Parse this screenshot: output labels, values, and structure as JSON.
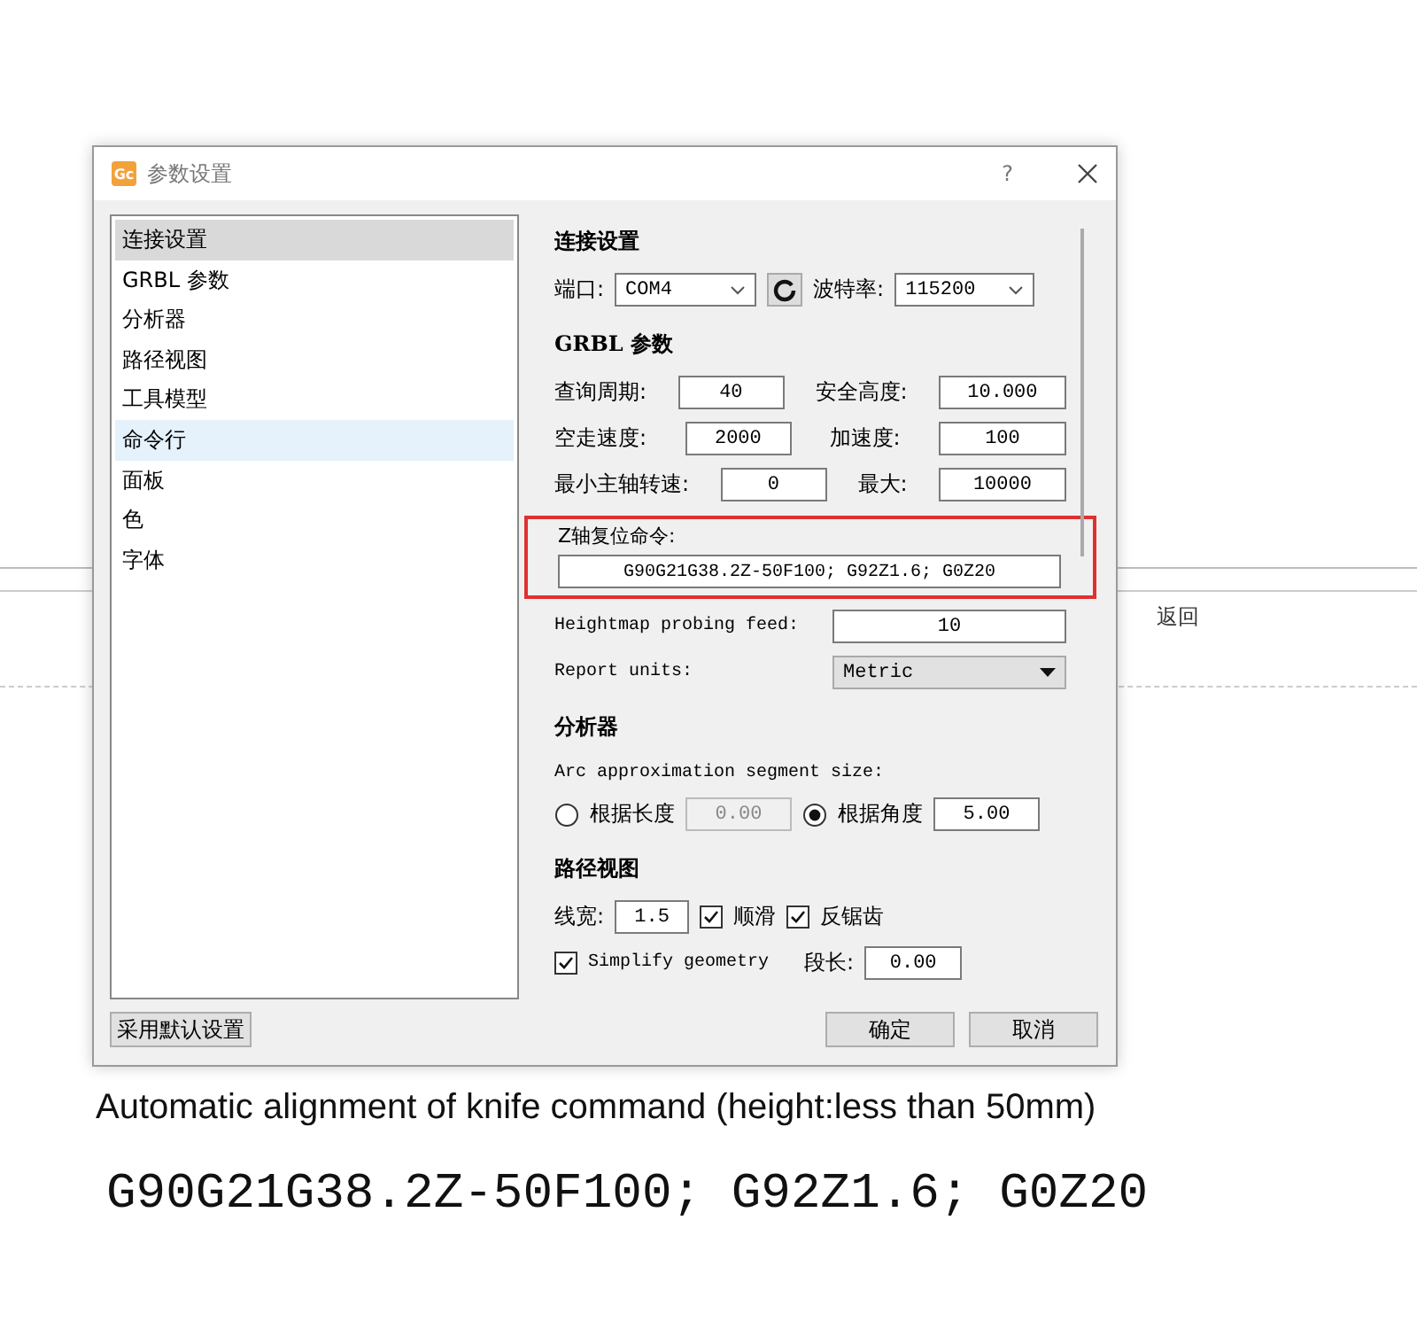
{
  "background_page": {
    "back_link": "返回"
  },
  "dialog": {
    "title": "参数设置",
    "app_icon": "Gc",
    "help": "?",
    "sidebar": {
      "items": [
        {
          "label": "连接设置",
          "selected": true,
          "hovered": false
        },
        {
          "label": "GRBL 参数",
          "selected": false,
          "hovered": false
        },
        {
          "label": "分析器",
          "selected": false,
          "hovered": false
        },
        {
          "label": "路径视图",
          "selected": false,
          "hovered": false
        },
        {
          "label": "工具模型",
          "selected": false,
          "hovered": false
        },
        {
          "label": "命令行",
          "selected": false,
          "hovered": true
        },
        {
          "label": "面板",
          "selected": false,
          "hovered": false
        },
        {
          "label": "色",
          "selected": false,
          "hovered": false
        },
        {
          "label": "字体",
          "selected": false,
          "hovered": false
        }
      ]
    },
    "connection": {
      "heading": "连接设置",
      "port_label": "端口:",
      "port_value": "COM4",
      "baud_label": "波特率:",
      "baud_value": "115200"
    },
    "grbl": {
      "heading": "GRBL 参数",
      "rows": [
        {
          "label_1": "查询周期:",
          "value_1": "40",
          "label_2": "安全高度:",
          "value_2": "10.000"
        },
        {
          "label_1": "空走速度:",
          "value_1": "2000",
          "label_2": "加速度:",
          "value_2": "100"
        },
        {
          "label_1": "最小主轴转速:",
          "value_1": "0",
          "label_2": "最大:",
          "value_2": "10000"
        }
      ],
      "z_reset_label": "Z轴复位命令:",
      "z_reset_value": "G90G21G38.2Z-50F100; G92Z1.6; G0Z20",
      "highlighted": true,
      "probe_feed_label": "Heightmap probing feed:",
      "probe_feed_value": "10",
      "units_label": "Report units:",
      "units_value": "Metric"
    },
    "analyzer": {
      "heading": "分析器",
      "arc_label": "Arc approximation segment size:",
      "options": [
        {
          "label": "根据长度",
          "value": "0.00",
          "selected": false
        },
        {
          "label": "根据角度",
          "value": "5.00",
          "selected": true
        }
      ]
    },
    "path_view": {
      "heading": "路径视图",
      "line_width_label": "线宽:",
      "line_width_value": "1.5",
      "checks": [
        {
          "label": "顺滑",
          "checked": true
        },
        {
          "label": "反锯齿",
          "checked": true
        }
      ],
      "simplify": {
        "label": "Simplify geometry",
        "checked": true
      },
      "segment_label": "段长:",
      "segment_value": "0.00"
    },
    "default_button": "采用默认设置",
    "ok_button": "确定",
    "cancel_button": "取消"
  },
  "caption": "Automatic alignment of knife command (height:less than 50mm)",
  "command": "G90G21G38.2Z-50F100; G92Z1.6; G0Z20"
}
